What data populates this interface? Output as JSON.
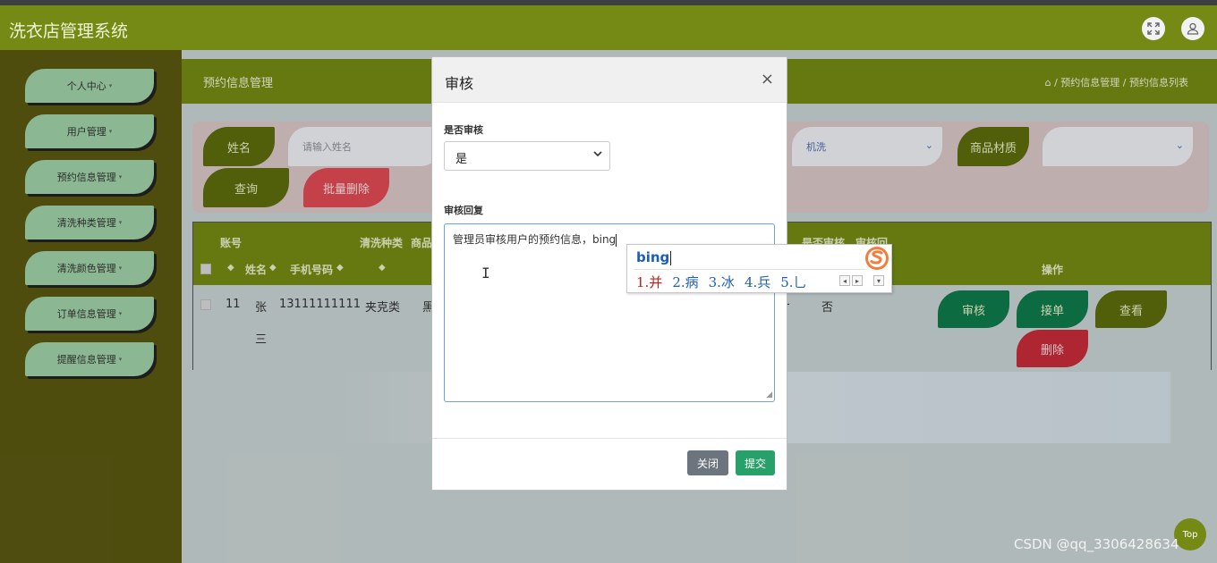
{
  "header": {
    "title": "洗衣店管理系统",
    "fullscreen_icon": "expand-icon",
    "user_icon": "user-icon"
  },
  "sidebar": {
    "items": [
      {
        "label": "个人中心"
      },
      {
        "label": "用户管理"
      },
      {
        "label": "预约信息管理"
      },
      {
        "label": "清洗种类管理"
      },
      {
        "label": "清洗颜色管理"
      },
      {
        "label": "订单信息管理"
      },
      {
        "label": "提醒信息管理"
      }
    ],
    "caret": "▾"
  },
  "page": {
    "title": "预约信息管理",
    "breadcrumb": "⌂ / 预约信息管理 / 预约信息列表"
  },
  "search": {
    "name_label": "姓名",
    "name_placeholder": "请输入姓名",
    "wash_value": "机洗",
    "material_label": "商品材质",
    "query_label": "查询",
    "batch_delete_label": "批量删除"
  },
  "table": {
    "header_top": {
      "account": "账号",
      "wash_type": "清洗种类",
      "goods": "商品",
      "audit": "是否审核",
      "reply": "审核回"
    },
    "header_bottom": {
      "name": "姓名",
      "phone": "手机号码",
      "ops": "操作"
    },
    "row": {
      "id": "11",
      "name_1": "张",
      "name_2": "三",
      "phone": "13111111111",
      "type": "夹克类",
      "color": "黑",
      "dash": "-",
      "audit": "否"
    },
    "ops": {
      "audit": "审核",
      "accept": "接单",
      "view": "查看",
      "delete": "删除"
    }
  },
  "modal": {
    "title": "审核",
    "close": "×",
    "audit_label": "是否审核",
    "audit_value": "是",
    "reply_label": "审核回复",
    "reply_value": "管理员审核用户的预约信息，bing",
    "btn_close": "关闭",
    "btn_submit": "提交"
  },
  "ime": {
    "pinyin": "bing",
    "candidates": [
      "1.并",
      "2.病",
      "3.冰",
      "4.兵",
      "5.乚"
    ]
  },
  "top_button": "Top",
  "watermark": "CSDN @qq_3306428634",
  "colors": {
    "olive": "#758a14",
    "sidebar": "#5a5811",
    "leaf_green": "#9fd1a8",
    "danger": "#e04a55",
    "primary": "#28a06a"
  }
}
